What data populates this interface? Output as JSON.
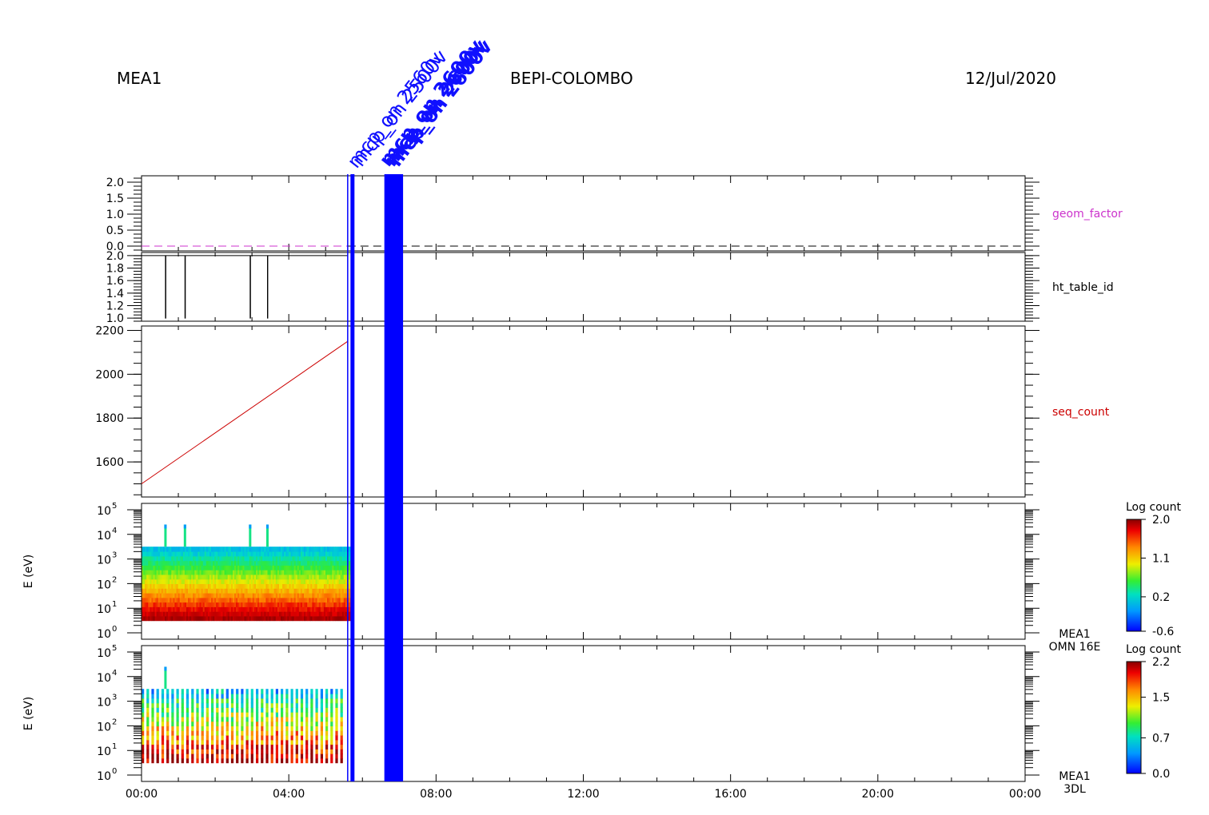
{
  "header": {
    "left_title": "MEA1",
    "center_title": "BEPI-COLOMBO",
    "date": "12/Jul/2020"
  },
  "time_axis": {
    "range_hours": [
      0,
      24
    ],
    "tick_labels": [
      "00:00",
      "04:00",
      "08:00",
      "12:00",
      "16:00",
      "20:00",
      "00:00"
    ],
    "tick_hours": [
      0,
      4,
      8,
      12,
      16,
      20,
      24
    ]
  },
  "annotations": {
    "angled_labels": [
      "mcp_on 2560v",
      "mcp_on 2500v",
      "mcp_on 2600v",
      "mcp_on 2600v",
      "mcp_on 2600v"
    ],
    "markers": [
      {
        "hour": 5.6,
        "color": "#0000ff",
        "bold": false
      },
      {
        "hour": 5.73,
        "color": "#0000ff",
        "bold": true
      },
      {
        "hour": 6.65,
        "color": "#0000ff",
        "bold": true
      },
      {
        "hour": 6.75,
        "color": "#0000ff",
        "bold": true
      },
      {
        "hour": 6.85,
        "color": "#0000ff",
        "bold": true
      },
      {
        "hour": 6.95,
        "color": "#0000ff",
        "bold": true
      },
      {
        "hour": 7.05,
        "color": "#0000ff",
        "bold": true
      }
    ]
  },
  "chart_data": [
    {
      "type": "line",
      "panel": "geom_factor",
      "label": "geom_factor",
      "label_color": "#cc33cc",
      "ylim": [
        -0.15,
        2.2
      ],
      "y_tick_labels": [
        "0.0",
        "0.5",
        "1.0",
        "1.5",
        "2.0"
      ],
      "y_ticks": [
        0.0,
        0.5,
        1.0,
        1.5,
        2.0
      ],
      "series": [
        {
          "x": [
            0.0,
            5.6
          ],
          "y": [
            0.0,
            0.0
          ],
          "color": "#cc33cc",
          "dashed": true
        },
        {
          "x": [
            5.6,
            24.0
          ],
          "y": [
            0.0,
            0.0
          ],
          "color": "#000000",
          "dashed": true
        }
      ]
    },
    {
      "type": "line",
      "panel": "ht_table_id",
      "label": "ht_table_id",
      "label_color": "#000000",
      "ylim": [
        0.95,
        2.05
      ],
      "y_tick_labels": [
        "1.0",
        "1.2",
        "1.4",
        "1.6",
        "1.8",
        "2.0"
      ],
      "y_ticks": [
        1.0,
        1.2,
        1.4,
        1.6,
        1.8,
        2.0
      ],
      "series": [
        {
          "x": [
            0.0,
            0.65,
            0.65,
            0.66,
            0.66,
            1.18,
            1.18,
            1.19,
            1.19,
            2.95,
            2.95,
            2.96,
            2.96,
            3.42,
            3.42,
            3.43,
            3.43,
            5.6
          ],
          "y": [
            2.0,
            2.0,
            1.0,
            1.0,
            2.0,
            2.0,
            1.0,
            1.0,
            2.0,
            2.0,
            1.0,
            1.0,
            2.0,
            2.0,
            1.0,
            1.0,
            2.0,
            2.0
          ],
          "color": "#000000",
          "dashed": false
        }
      ]
    },
    {
      "type": "line",
      "panel": "seq_count",
      "label": "seq_count",
      "label_color": "#cc0000",
      "ylim": [
        1440,
        2220
      ],
      "y_tick_labels": [
        "1600",
        "1800",
        "2000",
        "2200"
      ],
      "y_ticks": [
        1600,
        1800,
        2000,
        2200
      ],
      "series": [
        {
          "x": [
            0.0,
            5.6
          ],
          "y": [
            1500,
            2150
          ],
          "color": "#cc0000",
          "dashed": false
        }
      ]
    },
    {
      "type": "heatmap",
      "panel": "MEA1 OMN 16E",
      "ylabel": "E (eV)",
      "y_scale": "log",
      "y_decades": [
        0,
        5
      ],
      "y_tick_labels": [
        "0",
        "1",
        "2",
        "3",
        "4",
        "5"
      ],
      "data_extent": {
        "hours": [
          0.0,
          5.7
        ],
        "log_energy": [
          0.5,
          3.5
        ]
      },
      "spike_hours": [
        0.65,
        1.18,
        2.95,
        3.42
      ],
      "continuous": true,
      "side_labels": [
        "MEA1",
        "OMN 16E"
      ],
      "colorbar": {
        "title": "Log count",
        "range": [
          -0.6,
          2.0
        ],
        "tick_labels": [
          "-0.6",
          "0.2",
          "1.1",
          "2.0"
        ]
      }
    },
    {
      "type": "heatmap",
      "panel": "MEA1 3DL",
      "ylabel": "E (eV)",
      "y_scale": "log",
      "y_decades": [
        0,
        5
      ],
      "y_tick_labels": [
        "0",
        "1",
        "2",
        "3",
        "4",
        "5"
      ],
      "data_extent": {
        "hours": [
          0.0,
          5.5
        ],
        "log_energy": [
          0.5,
          3.5
        ]
      },
      "spike_hours": [
        0.65
      ],
      "continuous": false,
      "side_labels": [
        "MEA1",
        "3DL"
      ],
      "colorbar": {
        "title": "Log count",
        "range": [
          0.0,
          2.2
        ],
        "tick_labels": [
          "0.0",
          "0.7",
          "1.5",
          "2.2"
        ]
      }
    }
  ]
}
